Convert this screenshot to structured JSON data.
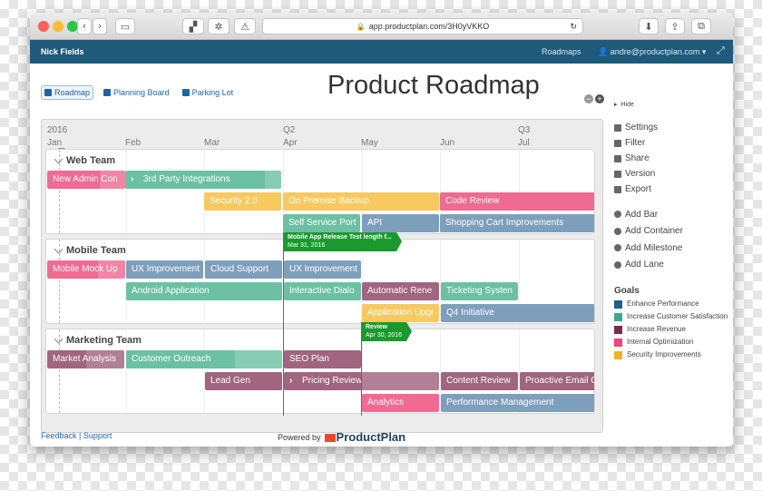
{
  "browser": {
    "url": "app.productplan.com/3H0yVKKO"
  },
  "topbar": {
    "user": "Nick Fields",
    "roadmaps": "Roadmaps",
    "account": "andre@productplan.com ▾"
  },
  "views": [
    {
      "label": "Roadmap"
    },
    {
      "label": "Planning Board"
    },
    {
      "label": "Parking Lot"
    }
  ],
  "page": {
    "title": "Product Roadmap"
  },
  "timeline": {
    "quarters": [
      "2016",
      "Q2",
      "Q3"
    ],
    "months": [
      "Jan",
      "Feb",
      "Mar",
      "Apr",
      "May",
      "Jun",
      "Jul"
    ]
  },
  "lanes": [
    {
      "name": "Web Team",
      "bars": [
        {
          "label": "New Admin Con",
          "goal": "Internal Optimization"
        },
        {
          "label": "3rd Party Integrations",
          "goal": "Increase Customer Satisfaction"
        },
        {
          "label": "Security 2.0",
          "goal": "Security Improvements"
        },
        {
          "label": "On Premise Backup",
          "goal": "Security Improvements"
        },
        {
          "label": "Code Review",
          "goal": "Internal Optimization"
        },
        {
          "label": "Self Service Port",
          "goal": "Increase Customer Satisfaction"
        },
        {
          "label": "API",
          "goal": "Enhance Performance"
        },
        {
          "label": "Shopping Cart Improvements",
          "goal": "Enhance Performance"
        }
      ]
    },
    {
      "name": "Mobile Team",
      "bars": [
        {
          "label": "Mobile Mock Up",
          "goal": "Internal Optimization"
        },
        {
          "label": "UX Improvement",
          "goal": "Enhance Performance"
        },
        {
          "label": "Cloud Support",
          "goal": "Enhance Performance"
        },
        {
          "label": "UX Improvement",
          "goal": "Enhance Performance"
        },
        {
          "label": "Android Application",
          "goal": "Increase Customer Satisfaction"
        },
        {
          "label": "Interactive Dialo",
          "goal": "Increase Customer Satisfaction"
        },
        {
          "label": "Automatic Rene",
          "goal": "Increase Revenue"
        },
        {
          "label": "Ticketing Systen",
          "goal": "Increase Customer Satisfaction"
        },
        {
          "label": "Application Upgr",
          "goal": "Security Improvements"
        },
        {
          "label": "Q4 Initiative",
          "goal": "Enhance Performance"
        }
      ]
    },
    {
      "name": "Marketing Team",
      "bars": [
        {
          "label": "Market Analysis",
          "goal": "Increase Revenue"
        },
        {
          "label": "Customer Outreach",
          "goal": "Increase Customer Satisfaction"
        },
        {
          "label": "SEO Plan",
          "goal": "Increase Revenue"
        },
        {
          "label": "Lead Gen",
          "goal": "Increase Revenue"
        },
        {
          "label": "Pricing Review",
          "goal": "Increase Revenue"
        },
        {
          "label": "Content Review",
          "goal": "Increase Revenue"
        },
        {
          "label": "Proactive Email C",
          "goal": "Increase Revenue"
        },
        {
          "label": "Analytics",
          "goal": "Internal Optimization"
        },
        {
          "label": "Performance Management",
          "goal": "Enhance Performance"
        }
      ]
    }
  ],
  "milestones": [
    {
      "title": "Mobile App Release Test length f...",
      "date": "Mar 31, 2016"
    },
    {
      "title": "Review",
      "date": "Apr 30, 2016"
    }
  ],
  "sidebar": {
    "hide": "Hide",
    "actions": [
      "Settings",
      "Filter",
      "Share",
      "Version",
      "Export"
    ],
    "add": [
      "Add Bar",
      "Add Container",
      "Add Milestone",
      "Add Lane"
    ],
    "goals_title": "Goals",
    "goals": [
      {
        "name": "Enhance Performance",
        "color": "#1f5f8b"
      },
      {
        "name": "Increase Customer Satisfaction",
        "color": "#3aaa8a"
      },
      {
        "name": "Increase Revenue",
        "color": "#7a2a55"
      },
      {
        "name": "Internal Optimization",
        "color": "#f2447a"
      },
      {
        "name": "Security Improvements",
        "color": "#f6b21d"
      }
    ]
  },
  "footer": {
    "feedback": "Feedback",
    "separator": "|",
    "support": "Support",
    "powered_by": "Powered by",
    "brand": "ProductPlan"
  }
}
